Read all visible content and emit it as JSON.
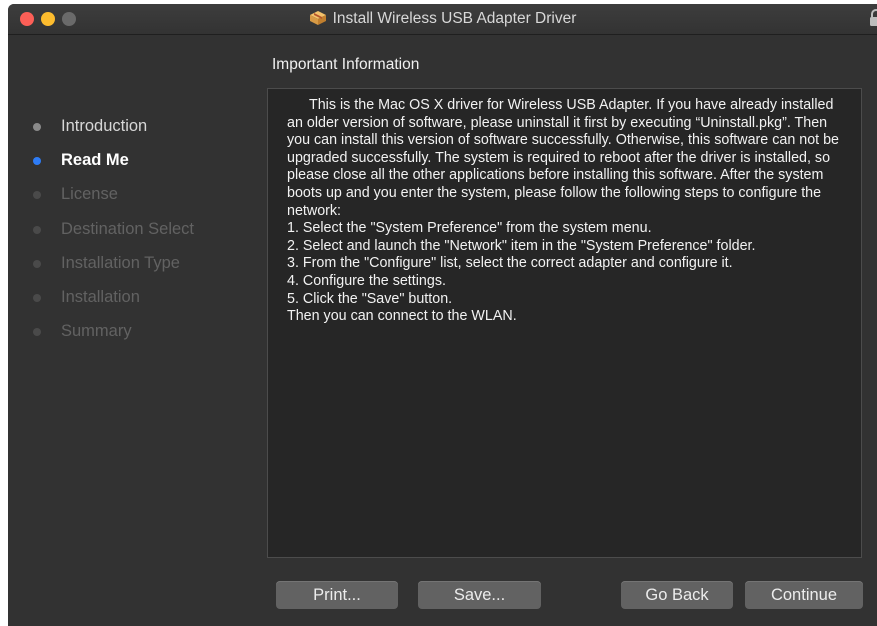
{
  "window": {
    "title": "Install Wireless USB Adapter Driver",
    "title_icon": "package-icon",
    "lock_icon": "lock-icon"
  },
  "sidebar": {
    "items": [
      {
        "label": "Introduction",
        "state": "done"
      },
      {
        "label": "Read Me",
        "state": "current"
      },
      {
        "label": "License",
        "state": "pending"
      },
      {
        "label": "Destination Select",
        "state": "pending"
      },
      {
        "label": "Installation Type",
        "state": "pending"
      },
      {
        "label": "Installation",
        "state": "pending"
      },
      {
        "label": "Summary",
        "state": "pending"
      }
    ]
  },
  "main": {
    "section_title": "Important Information",
    "paragraphs": [
      "This is the Mac OS X driver for Wireless USB Adapter. If you have already installed an older version of software, please uninstall it first by executing “Uninstall.pkg”. Then you can install this version of software successfully. Otherwise, this software can not be upgraded successfully. The system is required to reboot after the driver is installed, so please close all the other applications before installing this software. After the system boots up and you enter the system, please follow the following steps to configure the network:",
      "1. Select the \"System Preference\" from the system menu.",
      "2. Select and launch the \"Network\" item in the \"System Preference\" folder.",
      "3. From the \"Configure\" list, select the correct adapter and configure it.",
      "4. Configure the settings.",
      "5. Click the \"Save\" button.",
      "Then you can connect to the WLAN."
    ]
  },
  "buttons": {
    "print": "Print...",
    "save": "Save...",
    "go_back": "Go Back",
    "continue": "Continue"
  },
  "colors": {
    "window_bg": "#323232",
    "text_area_bg": "#262626",
    "current_step_dot": "#2e7cf6",
    "close": "#fc5f57",
    "minimize": "#fdbc2e"
  }
}
